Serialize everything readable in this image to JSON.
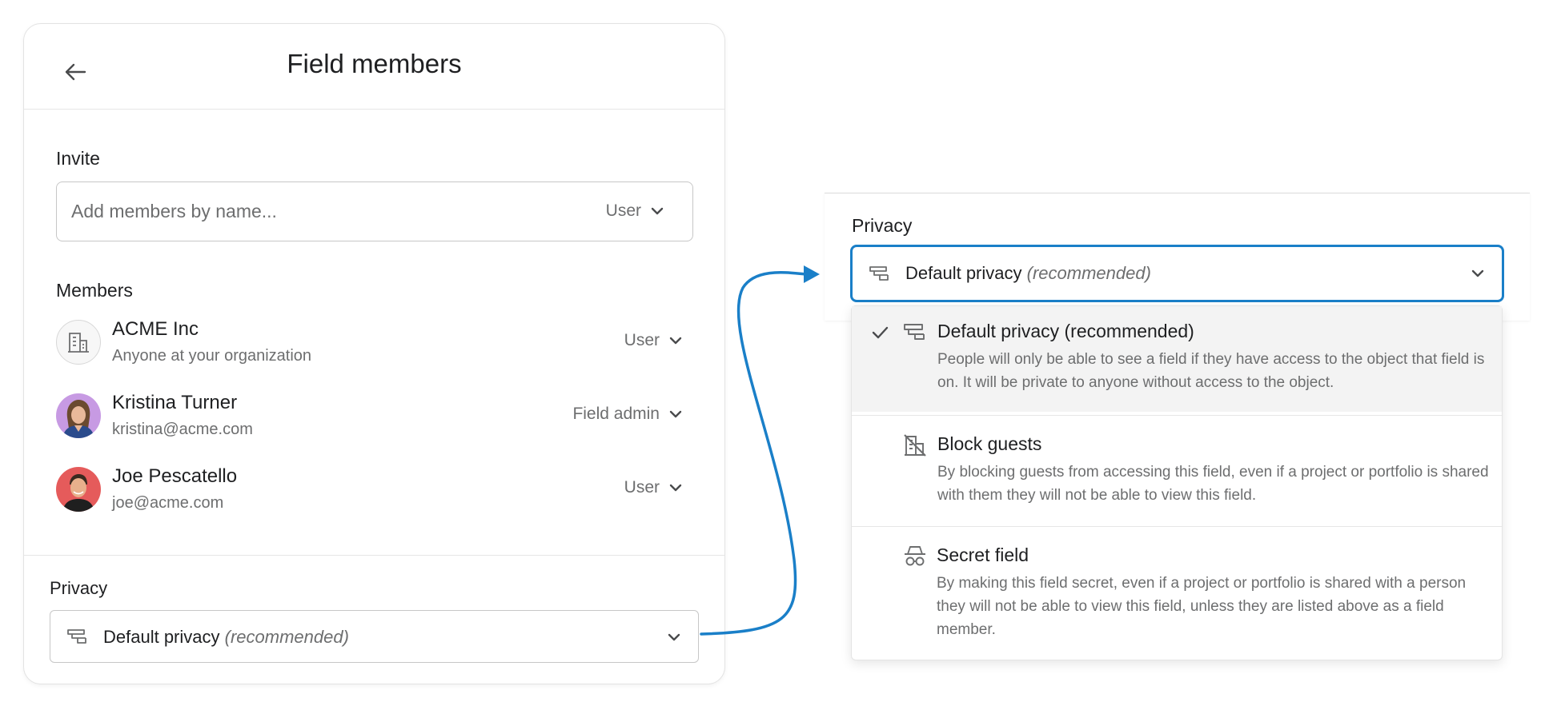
{
  "panel": {
    "title": "Field members",
    "invite": {
      "label": "Invite",
      "placeholder": "Add members by name...",
      "role": "User"
    },
    "members_label": "Members",
    "members": [
      {
        "name": "ACME Inc",
        "subtitle": "Anyone at your organization",
        "role": "User",
        "avatar": "building-icon"
      },
      {
        "name": "Kristina Turner",
        "subtitle": "kristina@acme.com",
        "role": "Field admin",
        "avatar": "photo"
      },
      {
        "name": "Joe Pescatello",
        "subtitle": "joe@acme.com",
        "role": "User",
        "avatar": "photo"
      }
    ],
    "privacy": {
      "label": "Privacy",
      "value": "Default privacy",
      "value_note": "(recommended)"
    }
  },
  "privacy_dropdown": {
    "label": "Privacy",
    "value": "Default privacy",
    "value_note": "(recommended)",
    "focus_color": "#1a7fc8",
    "options": [
      {
        "title": "Default privacy (recommended)",
        "description": "People will only be able to see a field if they have access to the object that field is on. It will be private to anyone without access to the object.",
        "icon": "privacy-layers-icon",
        "selected": true
      },
      {
        "title": "Block guests",
        "description": "By blocking guests from accessing this field, even if a project or portfolio is shared with them they will not be able to view this field.",
        "icon": "block-guests-icon",
        "selected": false
      },
      {
        "title": "Secret field",
        "description": "By making this field secret, even if a project or portfolio is shared with a person they will not be able to view this field, unless they are listed above as a field member.",
        "icon": "incognito-icon",
        "selected": false
      }
    ]
  },
  "colors": {
    "arrow": "#1a7fc8",
    "text": "#1e1f21",
    "muted": "#6d6e6f"
  }
}
